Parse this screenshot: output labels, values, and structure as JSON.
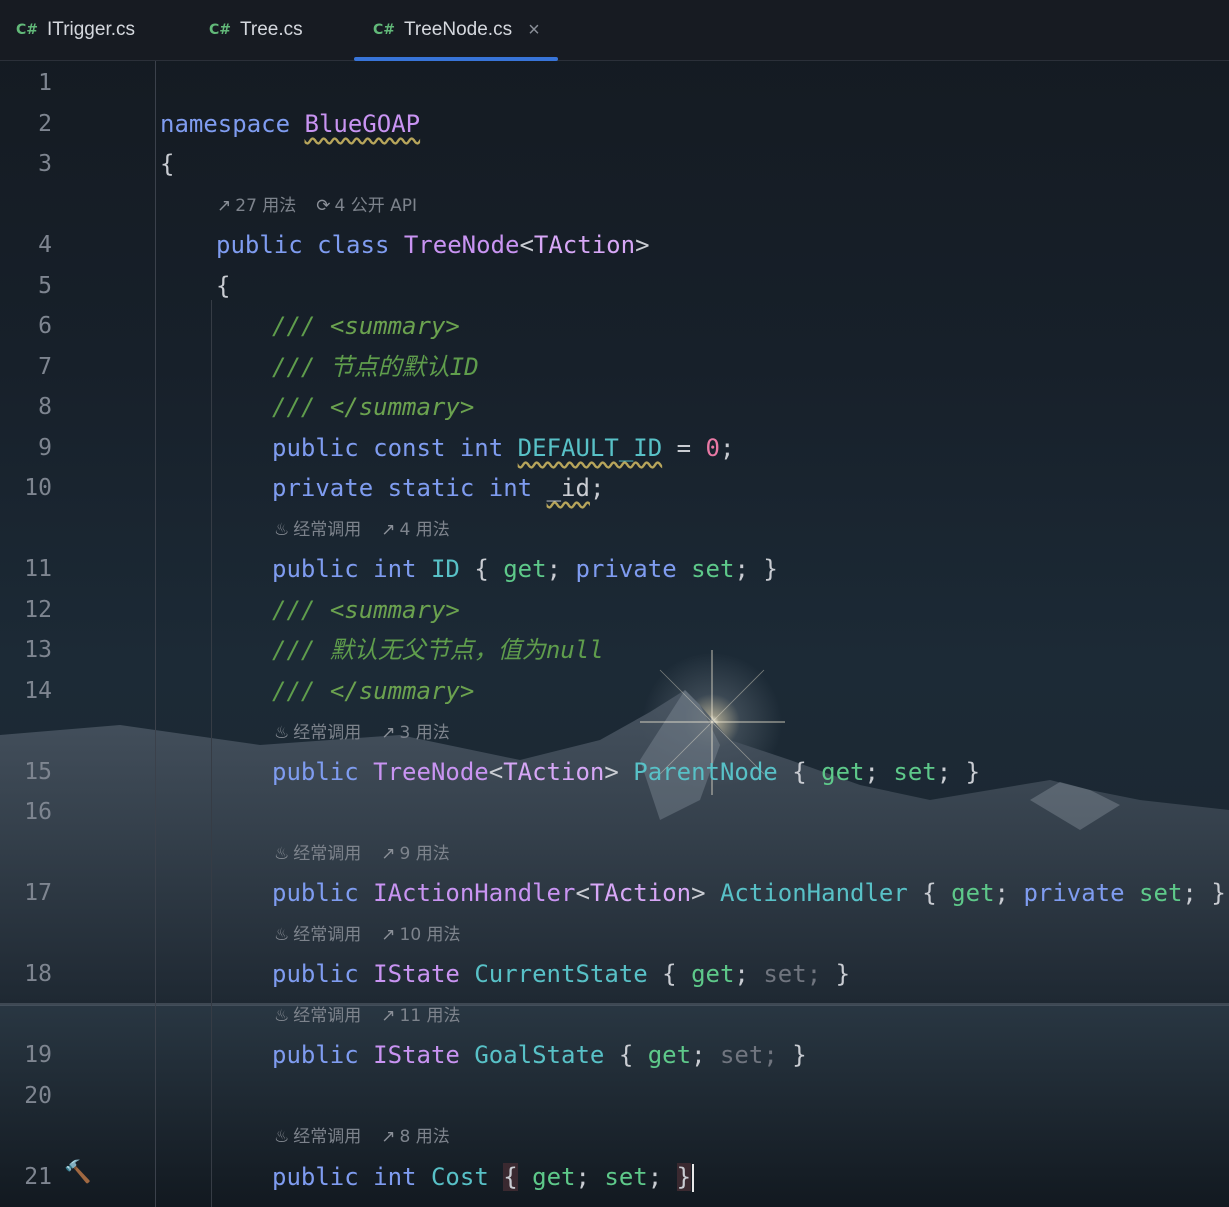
{
  "tabs": [
    {
      "badge": "C#",
      "name": "ITrigger.cs",
      "active": false
    },
    {
      "badge": "C#",
      "name": "Tree.cs",
      "active": false
    },
    {
      "badge": "C#",
      "name": "TreeNode.cs",
      "active": true,
      "close": "×"
    }
  ],
  "line_numbers": [
    "1",
    "2",
    "3",
    "4",
    "5",
    "6",
    "7",
    "8",
    "9",
    "10",
    "11",
    "12",
    "13",
    "14",
    "15",
    "16",
    "17",
    "18",
    "19",
    "20",
    "21"
  ],
  "inlay_hints": {
    "class_usages": "27 用法",
    "class_api": "4 公开 API",
    "frequently_called": "经常调用",
    "id_usages": "4 用法",
    "parent_usages": "3 用法",
    "handler_usages": "9 用法",
    "current_usages": "10 用法",
    "goal_usages": "11 用法",
    "cost_usages": "8 用法"
  },
  "code": {
    "l2_kw": "namespace",
    "l2_name": "BlueGOAP",
    "open_brace": "{",
    "close_brace": "}",
    "l4_public": "public",
    "l4_class": "class",
    "l4_name": "TreeNode",
    "l4_lt": "<",
    "l4_tparam": "TAction",
    "l4_gt": ">",
    "doc_slashes": "///",
    "summary_open": "<summary>",
    "summary_close": "</summary>",
    "l7_text": "节点的默认ID",
    "l9_public": "public",
    "l9_const": "const",
    "l9_int": "int",
    "l9_name": "DEFAULT_ID",
    "l9_eq": "=",
    "l9_val": "0",
    "semicolon": ";",
    "l10_private": "private",
    "l10_static": "static",
    "l10_int": "int",
    "l10_name": "_id",
    "l11_public": "public",
    "l11_int": "int",
    "l11_name": "ID",
    "get": "get",
    "set": "set",
    "private": "private",
    "l13_text": "默认无父节点，值为",
    "l13_null": "null",
    "l15_public": "public",
    "l15_type": "TreeNode",
    "l15_tparam": "TAction",
    "l15_name": "ParentNode",
    "l17_public": "public",
    "l17_type": "IActionHandler",
    "l17_tparam": "TAction",
    "l17_name": "ActionHandler",
    "l18_public": "public",
    "l18_type": "IState",
    "l18_name": "CurrentState",
    "l19_public": "public",
    "l19_type": "IState",
    "l19_name": "GoalState",
    "l21_public": "public",
    "l21_int": "int",
    "l21_name": "Cost"
  },
  "colors": {
    "keyword": "#7f9cf0",
    "type": "#c994f2",
    "property": "#58c1c7",
    "accessor": "#5ec98a",
    "number": "#e879a5",
    "doc_comment": "#5f9d4c",
    "tab_underline": "#3874d8"
  },
  "icons": [
    "csharp-file-icon",
    "close-icon",
    "usages-icon",
    "public-api-icon",
    "hot-call-icon",
    "hammer-icon"
  ]
}
